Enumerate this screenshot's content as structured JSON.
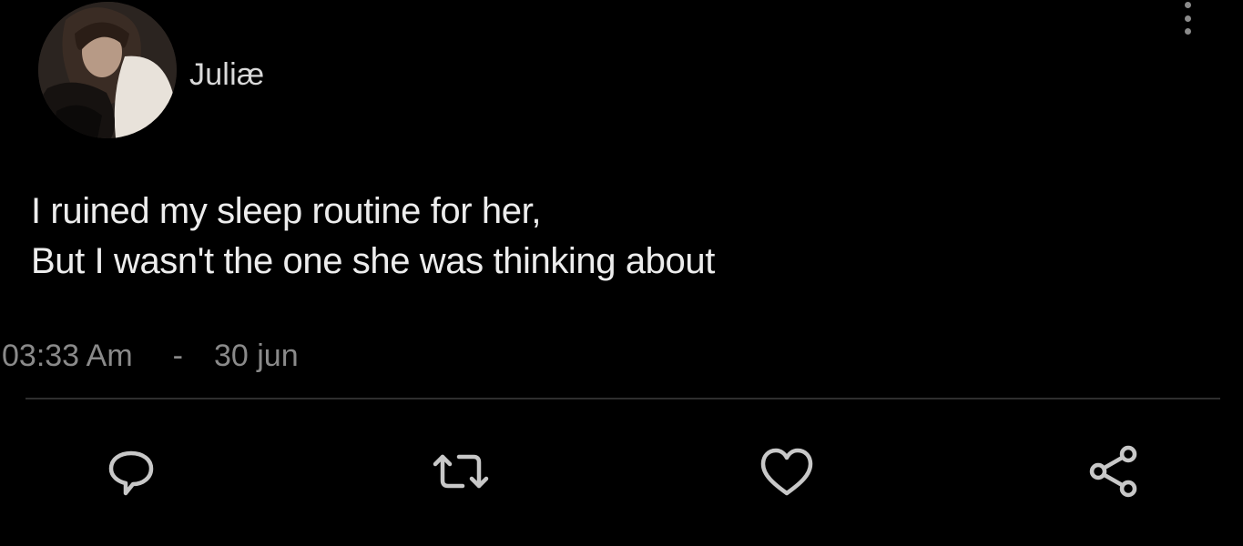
{
  "author": {
    "display_name": "Juliæ",
    "avatar_icon": "profile-photo"
  },
  "tweet": {
    "lines": [
      "I ruined my sleep routine for her,",
      "But I wasn't the one she was thinking about"
    ],
    "time": "03:33 Am",
    "separator": "-",
    "date": "30 jun"
  },
  "actions": {
    "reply_icon": "speech-bubble-icon",
    "retweet_icon": "retweet-icon",
    "like_icon": "heart-icon",
    "share_icon": "share-icon",
    "more_icon": "vertical-dots-icon"
  },
  "colors": {
    "background": "#000000",
    "text": "#ededed",
    "muted": "#8a8a8a",
    "icon": "#c8c8c8",
    "divider": "#2e2e2e"
  }
}
